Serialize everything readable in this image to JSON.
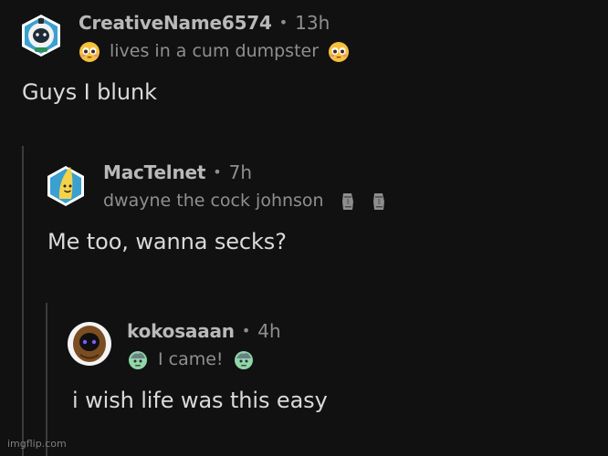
{
  "thread": {
    "comments": [
      {
        "username": "CreativeName6574",
        "time": "13h",
        "flair": "lives in a cum dumpster",
        "flair_emoji": "flushed-face-icon",
        "body": "Guys I blunk"
      },
      {
        "username": "MacTelnet",
        "time": "7h",
        "flair": "dwayne the cock johnson",
        "flair_emoji": "moai-icon",
        "body": "Me too, wanna secks?"
      },
      {
        "username": "kokosaaan",
        "time": "4h",
        "flair": "I came!",
        "flair_emoji": "zombie-icon",
        "body": "i wish life was this easy"
      }
    ],
    "separator": "•"
  },
  "watermark": "imgflip.com",
  "colors": {
    "background": "#111111",
    "username": "#b9b9b9",
    "meta": "#8f8f8f",
    "body": "#dadada",
    "thread_line": "#3b3b3b"
  }
}
